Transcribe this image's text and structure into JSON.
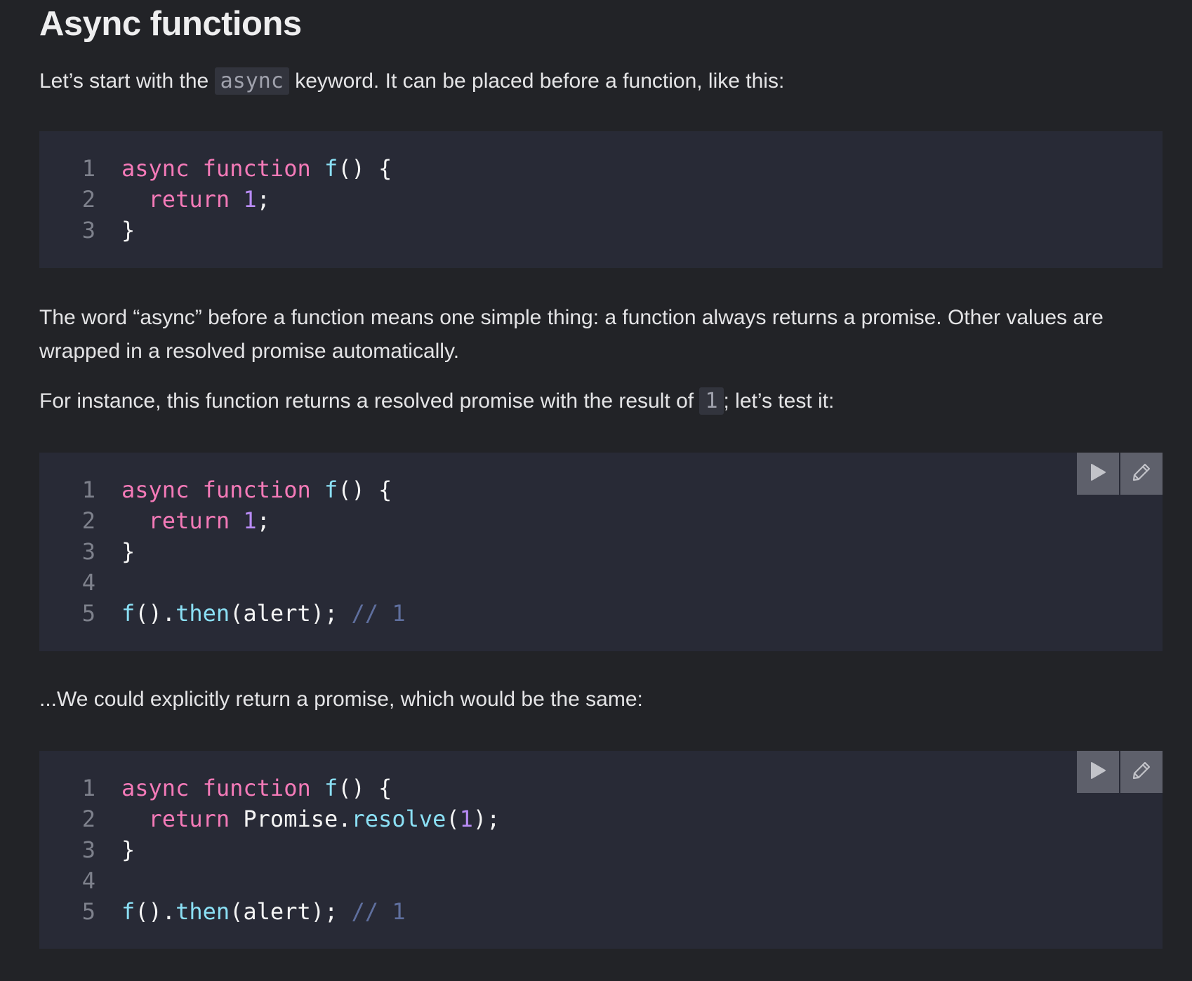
{
  "heading": "Async functions",
  "p1": {
    "before": "Let’s start with the ",
    "code": "async",
    "after": " keyword. It can be placed before a function, like this:"
  },
  "p2": "The word “async” before a function means one simple thing: a function always returns a promise. Other values are wrapped in a resolved promise automatically.",
  "p3": {
    "before": "For instance, this function returns a resolved promise with the result of ",
    "code": "1",
    "after": "; let’s test it:"
  },
  "p4": "...We could explicitly return a promise, which would be the same:",
  "colors": {
    "keyword": "#f47ab8",
    "func": "#8be0f5",
    "number": "#b98cf5",
    "comment": "#5f6f9e",
    "plain": "#f4f4f4"
  },
  "code_blocks": [
    {
      "runnable": false,
      "lines": [
        [
          [
            "keyword",
            "async "
          ],
          [
            "keyword",
            "function "
          ],
          [
            "func",
            "f"
          ],
          [
            "plain",
            "() {"
          ]
        ],
        [
          [
            "plain",
            "  "
          ],
          [
            "keyword",
            "return "
          ],
          [
            "number",
            "1"
          ],
          [
            "plain",
            ";"
          ]
        ],
        [
          [
            "plain",
            "}"
          ]
        ]
      ]
    },
    {
      "runnable": true,
      "run_icon": "play-icon",
      "edit_icon": "pencil-icon",
      "lines": [
        [
          [
            "keyword",
            "async "
          ],
          [
            "keyword",
            "function "
          ],
          [
            "func",
            "f"
          ],
          [
            "plain",
            "() {"
          ]
        ],
        [
          [
            "plain",
            "  "
          ],
          [
            "keyword",
            "return "
          ],
          [
            "number",
            "1"
          ],
          [
            "plain",
            ";"
          ]
        ],
        [
          [
            "plain",
            "}"
          ]
        ],
        [],
        [
          [
            "func",
            "f"
          ],
          [
            "plain",
            "()."
          ],
          [
            "func",
            "then"
          ],
          [
            "plain",
            "(alert); "
          ],
          [
            "comment",
            "// 1"
          ]
        ]
      ]
    },
    {
      "runnable": true,
      "run_icon": "play-icon",
      "edit_icon": "pencil-icon",
      "lines": [
        [
          [
            "keyword",
            "async "
          ],
          [
            "keyword",
            "function "
          ],
          [
            "func",
            "f"
          ],
          [
            "plain",
            "() {"
          ]
        ],
        [
          [
            "plain",
            "  "
          ],
          [
            "keyword",
            "return "
          ],
          [
            "plain",
            "Promise."
          ],
          [
            "func",
            "resolve"
          ],
          [
            "plain",
            "("
          ],
          [
            "number",
            "1"
          ],
          [
            "plain",
            ");"
          ]
        ],
        [
          [
            "plain",
            "}"
          ]
        ],
        [],
        [
          [
            "func",
            "f"
          ],
          [
            "plain",
            "()."
          ],
          [
            "func",
            "then"
          ],
          [
            "plain",
            "(alert); "
          ],
          [
            "comment",
            "// 1"
          ]
        ]
      ]
    }
  ]
}
